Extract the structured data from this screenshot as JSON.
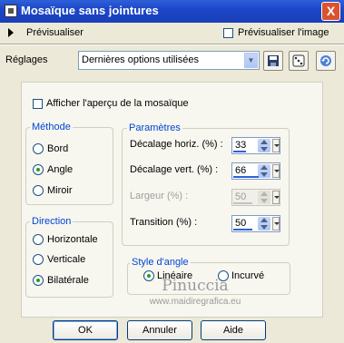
{
  "window": {
    "title": "Mosaïque sans jointures",
    "close": "X"
  },
  "preview": {
    "left_label": "Prévisualiser",
    "right_label": "Prévisualiser l'image",
    "right_checked": false
  },
  "settings": {
    "label": "Réglages",
    "value": "Dernières options utilisées"
  },
  "show_preview": {
    "label": "Afficher l'aperçu de la mosaïque",
    "checked": false
  },
  "method": {
    "legend": "Méthode",
    "options": [
      "Bord",
      "Angle",
      "Miroir"
    ],
    "selected": "Angle"
  },
  "direction": {
    "legend": "Direction",
    "options": [
      "Horizontale",
      "Verticale",
      "Bilatérale"
    ],
    "selected": "Bilatérale"
  },
  "params": {
    "legend": "Paramètres",
    "rows": [
      {
        "label": "Décalage horiz. (%) :",
        "value": "33",
        "enabled": true,
        "fill": 0.33
      },
      {
        "label": "Décalage vert. (%) :",
        "value": "66",
        "enabled": true,
        "fill": 0.66
      },
      {
        "label": "Largeur (%) :",
        "value": "50",
        "enabled": false,
        "fill": 0.5
      },
      {
        "label": "Transition (%) :",
        "value": "50",
        "enabled": true,
        "fill": 0.5
      }
    ]
  },
  "corner_style": {
    "legend": "Style d'angle",
    "options": [
      "Linéaire",
      "Incurvé"
    ],
    "selected": "Linéaire"
  },
  "watermark": {
    "name": "Pinuccia",
    "url": "www.maidiregrafica.eu"
  },
  "buttons": {
    "ok": "OK",
    "cancel": "Annuler",
    "help": "Aide"
  },
  "colors": {
    "title_bar": "#1c47c9",
    "legend": "#0046d5",
    "dialog": "#ece9d8"
  }
}
